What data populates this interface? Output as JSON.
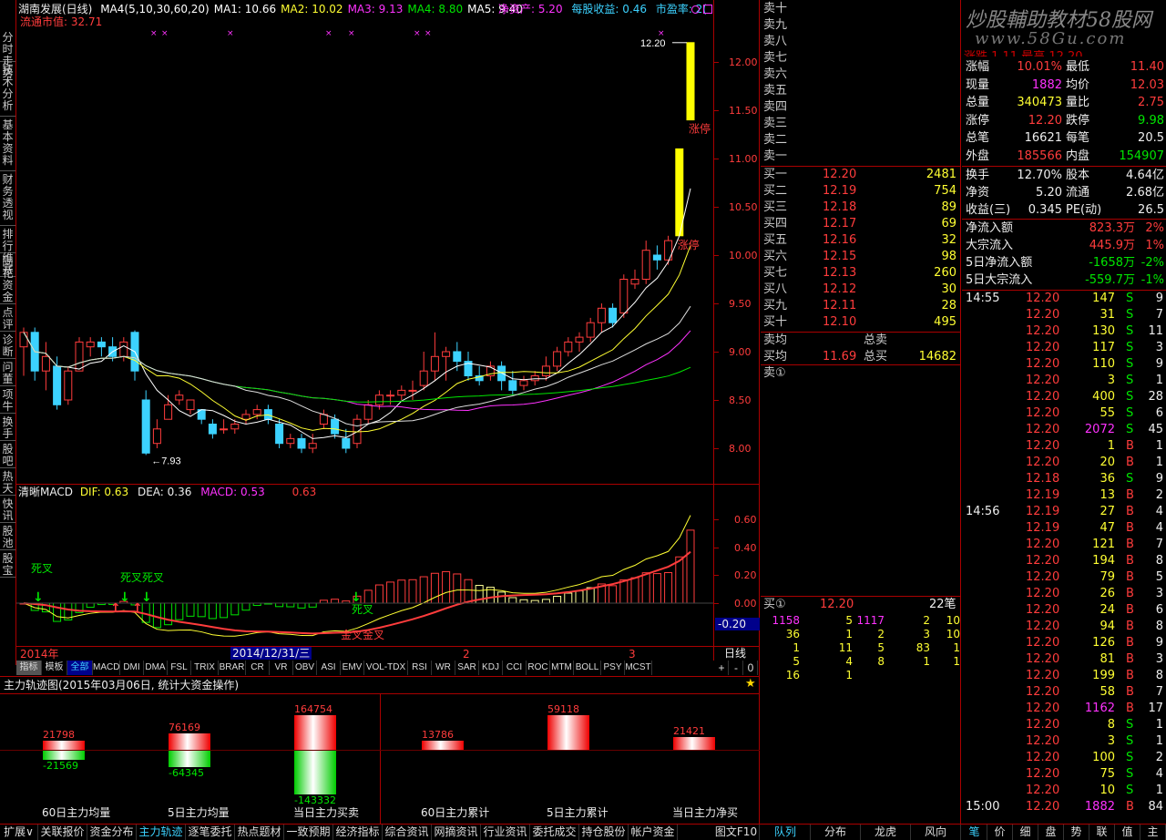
{
  "header": {
    "title": "湖南发展(日线)",
    "ma_items": [
      {
        "label": "MA4(5,10,30,60,20)",
        "color": "#ffffff"
      },
      {
        "label": "MA1: 10.66",
        "color": "#ffffff"
      },
      {
        "label": "MA2: 10.02",
        "color": "#ffff32"
      },
      {
        "label": "MA3: 9.13",
        "color": "#ff32ff"
      },
      {
        "label": "MA4: 8.80",
        "color": "#00e600"
      },
      {
        "label": "MA5: 9.40",
        "color": "#ffffff"
      }
    ],
    "nav_label": "净资产: 5.20",
    "eps_label": "每股收益: 0.46",
    "pe_label": "市盈率: 2(",
    "float_cap": "流通市值: 32.71"
  },
  "price_axis": [
    "12.00",
    "11.50",
    "11.00",
    "10.50",
    "10.00",
    "9.50",
    "9.00",
    "8.50",
    "8.00"
  ],
  "price_annotations": {
    "high": "12.20",
    "low": "7.93",
    "limit_up_1": "涨停",
    "limit_up_2": "涨停"
  },
  "macd": {
    "title": "清晰MACD",
    "dif": "DIF: 0.63",
    "dea": "DEA: 0.36",
    "macd": "MACD: 0.53",
    "extra": "0.63",
    "axis": [
      "0.60",
      "0.40",
      "0.20",
      "0.00"
    ],
    "cursor_value": "-0.20",
    "labels": {
      "dead1": "死叉",
      "dead2": "死叉死叉",
      "gold1": "死叉",
      "gold2": "金叉金叉"
    }
  },
  "time_axis": {
    "year": "2014年",
    "date": "2014/12/31/三",
    "m2": "2",
    "m3": "3",
    "period": "日线"
  },
  "left_tabs": [
    "分时走势",
    "技术分析",
    "基本资料",
    "财务透视",
    "排行维赛",
    "同花",
    "资金",
    "点评",
    "诊断",
    "问董",
    "项牛",
    "换手",
    "股吧",
    "热天",
    "快讯",
    "股池",
    "股宝"
  ],
  "indicator_tabs": [
    "指标",
    "模板",
    "全部",
    "MACD",
    "DMI",
    "DMA",
    "FSL",
    "TRIX",
    "BRAR",
    "CR",
    "VR",
    "OBV",
    "ASI",
    "EMV",
    "VOL-TDX",
    "RSI",
    "WR",
    "SAR",
    "KDJ",
    "CCI",
    "ROC",
    "MTM",
    "BOLL",
    "PSY",
    "MCST"
  ],
  "zoom_buttons": [
    "+",
    "-",
    "0"
  ],
  "fund_panel": {
    "title": "主力轨迹图(2015年03月06日, 统计大资金操作)",
    "items": [
      {
        "label": "60日主力均量",
        "top": "21798",
        "bottom": "-21569"
      },
      {
        "label": "5日主力均量",
        "top": "76169",
        "bottom": "-64345"
      },
      {
        "label": "当日主力买卖",
        "top": "164754",
        "bottom": "-143332"
      },
      {
        "label": "60日主力累计",
        "top": "13786",
        "bottom": ""
      },
      {
        "label": "5日主力累计",
        "top": "59118",
        "bottom": ""
      },
      {
        "label": "当日主力净买",
        "top": "21421",
        "bottom": ""
      }
    ]
  },
  "sell_orders": [
    "卖十",
    "卖九",
    "卖八",
    "卖七",
    "卖六",
    "卖五",
    "卖四",
    "卖三",
    "卖二",
    "卖一"
  ],
  "buy_orders": [
    {
      "label": "买一",
      "price": "12.20",
      "vol": "2481"
    },
    {
      "label": "买二",
      "price": "12.19",
      "vol": "754"
    },
    {
      "label": "买三",
      "price": "12.18",
      "vol": "89"
    },
    {
      "label": "买四",
      "price": "12.17",
      "vol": "69"
    },
    {
      "label": "买五",
      "price": "12.16",
      "vol": "32"
    },
    {
      "label": "买六",
      "price": "12.15",
      "vol": "98"
    },
    {
      "label": "买七",
      "price": "12.13",
      "vol": "260"
    },
    {
      "label": "买八",
      "price": "12.12",
      "vol": "30"
    },
    {
      "label": "买九",
      "price": "12.11",
      "vol": "28"
    },
    {
      "label": "买十",
      "price": "12.10",
      "vol": "495"
    }
  ],
  "avg": {
    "sell_avg": "卖均",
    "total_sell": "总卖",
    "buy_avg": "买均",
    "buy_avg_price": "11.69",
    "total_buy": "总买",
    "total_buy_vol": "14682",
    "sell1_queue": "卖①"
  },
  "buy1_queue": {
    "label": "买①",
    "price": "12.20",
    "count": "22笔",
    "rows": [
      [
        "1158",
        "5",
        "1117",
        "2",
        "10"
      ],
      [
        "36",
        "1",
        "2",
        "3",
        "10"
      ],
      [
        "1",
        "11",
        "5",
        "83",
        "1"
      ],
      [
        "5",
        "4",
        "8",
        "1",
        "1"
      ],
      [
        "16",
        "1",
        "",
        "",
        ""
      ]
    ]
  },
  "right_top": {
    "watermark": "炒股輔助教材58股网",
    "site": "www.58Gu.com",
    "partial_row": "涨跌   1.11  最高   12.20"
  },
  "stats": [
    {
      "l1": "涨幅",
      "v1": "10.01%",
      "c1": "#ff3c3c",
      "l2": "最低",
      "v2": "11.40",
      "c2": "#ff3c3c"
    },
    {
      "l1": "现量",
      "v1": "1882",
      "c1": "#ff32ff",
      "l2": "均价",
      "v2": "12.03",
      "c2": "#ff3c3c"
    },
    {
      "l1": "总量",
      "v1": "340473",
      "c1": "#ffff32",
      "l2": "量比",
      "v2": "2.75",
      "c2": "#ff3c3c"
    },
    {
      "l1": "涨停",
      "v1": "12.20",
      "c1": "#ff3c3c",
      "l2": "跌停",
      "v2": "9.98",
      "c2": "#00e600"
    },
    {
      "l1": "总笔",
      "v1": "16621",
      "c1": "#eee",
      "l2": "每笔",
      "v2": "20.5",
      "c2": "#eee"
    },
    {
      "l1": "外盘",
      "v1": "185566",
      "c1": "#ff3c3c",
      "l2": "内盘",
      "v2": "154907",
      "c2": "#00e600"
    }
  ],
  "stats2": [
    {
      "l1": "换手",
      "v1": "12.70%",
      "l2": "股本",
      "v2": "4.64亿"
    },
    {
      "l1": "净资",
      "v1": "5.20",
      "l2": "流通",
      "v2": "2.68亿"
    },
    {
      "l1": "收益(三)",
      "v1": "0.345",
      "l2": "PE(动)",
      "v2": "26.5"
    }
  ],
  "flows": [
    {
      "l": "净流入额",
      "v": "823.3万",
      "p": "2%",
      "c": "#ff3c3c"
    },
    {
      "l": "大宗流入",
      "v": "445.9万",
      "p": "1%",
      "c": "#ff3c3c"
    },
    {
      "l": "5日净流入额",
      "v": "-1658万",
      "p": "-2%",
      "c": "#00e600"
    },
    {
      "l": "5日大宗流入",
      "v": "-559.7万",
      "p": "-1%",
      "c": "#00e600"
    }
  ],
  "ticks": [
    {
      "t": "14:55",
      "p": "12.20",
      "v": "147",
      "s": "S",
      "n": "9"
    },
    {
      "t": "",
      "p": "12.20",
      "v": "31",
      "s": "S",
      "n": "7"
    },
    {
      "t": "",
      "p": "12.20",
      "v": "130",
      "s": "S",
      "n": "11"
    },
    {
      "t": "",
      "p": "12.20",
      "v": "117",
      "s": "S",
      "n": "3"
    },
    {
      "t": "",
      "p": "12.20",
      "v": "110",
      "s": "S",
      "n": "9"
    },
    {
      "t": "",
      "p": "12.20",
      "v": "3",
      "s": "S",
      "n": "1"
    },
    {
      "t": "",
      "p": "12.20",
      "v": "400",
      "s": "S",
      "n": "28"
    },
    {
      "t": "",
      "p": "12.20",
      "v": "55",
      "s": "S",
      "n": "6"
    },
    {
      "t": "",
      "p": "12.20",
      "v": "2072",
      "s": "S",
      "n": "45"
    },
    {
      "t": "",
      "p": "12.20",
      "v": "1",
      "s": "B",
      "n": "1"
    },
    {
      "t": "",
      "p": "12.20",
      "v": "20",
      "s": "B",
      "n": "1"
    },
    {
      "t": "",
      "p": "12.18",
      "v": "36",
      "s": "S",
      "n": "9"
    },
    {
      "t": "",
      "p": "12.19",
      "v": "13",
      "s": "B",
      "n": "2"
    },
    {
      "t": "14:56",
      "p": "12.19",
      "v": "27",
      "s": "B",
      "n": "4"
    },
    {
      "t": "",
      "p": "12.19",
      "v": "47",
      "s": "B",
      "n": "4"
    },
    {
      "t": "",
      "p": "12.20",
      "v": "121",
      "s": "B",
      "n": "7"
    },
    {
      "t": "",
      "p": "12.20",
      "v": "194",
      "s": "B",
      "n": "8"
    },
    {
      "t": "",
      "p": "12.20",
      "v": "79",
      "s": "B",
      "n": "5"
    },
    {
      "t": "",
      "p": "12.20",
      "v": "26",
      "s": "B",
      "n": "3"
    },
    {
      "t": "",
      "p": "12.20",
      "v": "24",
      "s": "B",
      "n": "6"
    },
    {
      "t": "",
      "p": "12.20",
      "v": "94",
      "s": "B",
      "n": "8"
    },
    {
      "t": "",
      "p": "12.20",
      "v": "126",
      "s": "B",
      "n": "9"
    },
    {
      "t": "",
      "p": "12.20",
      "v": "81",
      "s": "B",
      "n": "3"
    },
    {
      "t": "",
      "p": "12.20",
      "v": "199",
      "s": "B",
      "n": "8"
    },
    {
      "t": "",
      "p": "12.20",
      "v": "58",
      "s": "B",
      "n": "7"
    },
    {
      "t": "",
      "p": "12.20",
      "v": "1162",
      "s": "B",
      "n": "17"
    },
    {
      "t": "",
      "p": "12.20",
      "v": "8",
      "s": "S",
      "n": "1"
    },
    {
      "t": "",
      "p": "12.20",
      "v": "3",
      "s": "S",
      "n": "1"
    },
    {
      "t": "",
      "p": "12.20",
      "v": "100",
      "s": "S",
      "n": "2"
    },
    {
      "t": "",
      "p": "12.20",
      "v": "75",
      "s": "S",
      "n": "4"
    },
    {
      "t": "",
      "p": "12.20",
      "v": "10",
      "s": "S",
      "n": "1"
    },
    {
      "t": "15:00",
      "p": "12.20",
      "v": "1882",
      "s": "B",
      "n": "84"
    }
  ],
  "bottom_tabs": [
    "扩展∨",
    "关联报价",
    "资金分布",
    "主力轨迹",
    "逐笔委托",
    "热点题材",
    "一致预期",
    "经济指标",
    "综合资讯",
    "网摘资讯",
    "行业资讯",
    "委托成交",
    "持仓股份",
    "帐户资金"
  ],
  "bottom_right": [
    "图文F10"
  ],
  "mid_bottom_tabs": [
    "队列",
    "分布",
    "龙虎",
    "风向"
  ],
  "right_bottom_tabs": [
    "笔",
    "价",
    "细",
    "盘",
    "势",
    "联",
    "值",
    "主"
  ],
  "candles": [
    {
      "o": 9.05,
      "c": 9.2,
      "h": 9.25,
      "l": 8.75
    },
    {
      "o": 9.2,
      "c": 8.8,
      "h": 9.25,
      "l": 8.7
    },
    {
      "o": 8.8,
      "c": 8.95,
      "h": 9.1,
      "l": 8.6
    },
    {
      "o": 8.85,
      "c": 8.45,
      "h": 8.95,
      "l": 8.4
    },
    {
      "o": 8.5,
      "c": 8.8,
      "h": 8.85,
      "l": 8.45
    },
    {
      "o": 8.8,
      "c": 9.1,
      "h": 9.15,
      "l": 8.8
    },
    {
      "o": 9.05,
      "c": 9.1,
      "h": 9.15,
      "l": 8.95
    },
    {
      "o": 9.1,
      "c": 9.05,
      "h": 9.15,
      "l": 8.95
    },
    {
      "o": 9.05,
      "c": 8.95,
      "h": 9.15,
      "l": 8.9
    },
    {
      "o": 8.95,
      "c": 9.1,
      "h": 9.15,
      "l": 8.9
    },
    {
      "o": 9.2,
      "c": 8.8,
      "h": 9.22,
      "l": 8.7
    },
    {
      "o": 8.5,
      "c": 7.95,
      "h": 8.6,
      "l": 7.93
    },
    {
      "o": 8.05,
      "c": 8.2,
      "h": 8.3,
      "l": 8.0
    },
    {
      "o": 8.3,
      "c": 8.45,
      "h": 8.55,
      "l": 8.3
    },
    {
      "o": 8.5,
      "c": 8.55,
      "h": 8.6,
      "l": 8.45
    },
    {
      "o": 8.4,
      "c": 8.5,
      "h": 8.5,
      "l": 8.35
    },
    {
      "o": 8.4,
      "c": 8.3,
      "h": 8.4,
      "l": 8.25
    },
    {
      "o": 8.25,
      "c": 8.15,
      "h": 8.3,
      "l": 8.1
    },
    {
      "o": 8.2,
      "c": 8.2,
      "h": 8.3,
      "l": 8.15
    },
    {
      "o": 8.2,
      "c": 8.25,
      "h": 8.3,
      "l": 8.15
    },
    {
      "o": 8.3,
      "c": 8.35,
      "h": 8.4,
      "l": 8.25
    },
    {
      "o": 8.35,
      "c": 8.4,
      "h": 8.45,
      "l": 8.3
    },
    {
      "o": 8.4,
      "c": 8.3,
      "h": 8.45,
      "l": 8.25
    },
    {
      "o": 8.25,
      "c": 8.05,
      "h": 8.3,
      "l": 8.0
    },
    {
      "o": 8.05,
      "c": 8.1,
      "h": 8.15,
      "l": 8.0
    },
    {
      "o": 8.1,
      "c": 8.0,
      "h": 8.15,
      "l": 7.95
    },
    {
      "o": 8.0,
      "c": 8.05,
      "h": 8.15,
      "l": 7.95
    },
    {
      "o": 8.25,
      "c": 8.35,
      "h": 8.4,
      "l": 8.2
    },
    {
      "o": 8.3,
      "c": 8.15,
      "h": 8.35,
      "l": 8.1
    },
    {
      "o": 8.1,
      "c": 8.0,
      "h": 8.2,
      "l": 7.95
    },
    {
      "o": 8.05,
      "c": 8.3,
      "h": 8.35,
      "l": 8.0
    },
    {
      "o": 8.3,
      "c": 8.45,
      "h": 8.5,
      "l": 8.25
    },
    {
      "o": 8.45,
      "c": 8.55,
      "h": 8.6,
      "l": 8.4
    },
    {
      "o": 8.55,
      "c": 8.55,
      "h": 8.6,
      "l": 8.45
    },
    {
      "o": 8.55,
      "c": 8.6,
      "h": 8.65,
      "l": 8.5
    },
    {
      "o": 8.6,
      "c": 8.6,
      "h": 8.7,
      "l": 8.5
    },
    {
      "o": 8.65,
      "c": 8.8,
      "h": 9.0,
      "l": 8.6
    },
    {
      "o": 8.8,
      "c": 8.95,
      "h": 9.2,
      "l": 8.7
    },
    {
      "o": 8.95,
      "c": 9.0,
      "h": 9.05,
      "l": 8.7
    },
    {
      "o": 9.0,
      "c": 8.9,
      "h": 9.1,
      "l": 8.8
    },
    {
      "o": 8.9,
      "c": 8.75,
      "h": 9.0,
      "l": 8.7
    },
    {
      "o": 8.75,
      "c": 8.7,
      "h": 8.85,
      "l": 8.65
    },
    {
      "o": 8.75,
      "c": 8.85,
      "h": 8.9,
      "l": 8.7
    },
    {
      "o": 8.85,
      "c": 8.7,
      "h": 8.9,
      "l": 8.6
    },
    {
      "o": 8.7,
      "c": 8.6,
      "h": 8.8,
      "l": 8.55
    },
    {
      "o": 8.65,
      "c": 8.7,
      "h": 8.75,
      "l": 8.6
    },
    {
      "o": 8.7,
      "c": 8.75,
      "h": 8.8,
      "l": 8.65
    },
    {
      "o": 8.75,
      "c": 8.85,
      "h": 8.95,
      "l": 8.7
    },
    {
      "o": 8.85,
      "c": 9.0,
      "h": 9.05,
      "l": 8.8
    },
    {
      "o": 9.0,
      "c": 9.1,
      "h": 9.15,
      "l": 8.95
    },
    {
      "o": 9.1,
      "c": 9.15,
      "h": 9.2,
      "l": 9.0
    },
    {
      "o": 9.15,
      "c": 9.3,
      "h": 9.35,
      "l": 9.1
    },
    {
      "o": 9.3,
      "c": 9.45,
      "h": 9.5,
      "l": 9.2
    },
    {
      "o": 9.45,
      "c": 9.3,
      "h": 9.5,
      "l": 9.25
    },
    {
      "o": 9.4,
      "c": 9.75,
      "h": 9.8,
      "l": 9.35
    },
    {
      "o": 9.7,
      "c": 9.75,
      "h": 9.85,
      "l": 9.65
    },
    {
      "o": 9.75,
      "c": 10.05,
      "h": 10.15,
      "l": 9.7
    },
    {
      "o": 10.0,
      "c": 9.95,
      "h": 10.1,
      "l": 9.85
    },
    {
      "o": 9.95,
      "c": 10.15,
      "h": 10.2,
      "l": 9.9
    },
    {
      "o": 10.2,
      "c": 11.1,
      "h": 11.1,
      "l": 10.2
    },
    {
      "o": 11.4,
      "c": 12.2,
      "h": 12.2,
      "l": 11.4
    }
  ]
}
